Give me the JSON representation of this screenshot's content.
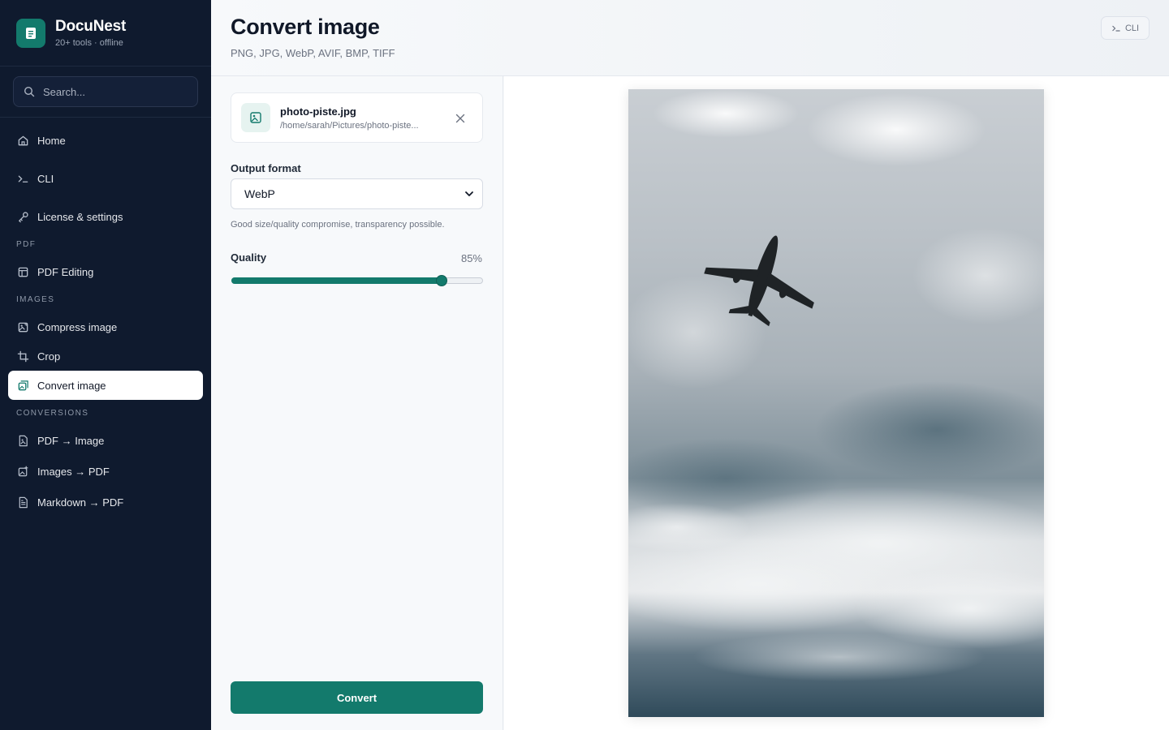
{
  "brand": {
    "title": "DocuNest",
    "subtitle": "20+ tools · offline",
    "logo_icon": "document-icon"
  },
  "search": {
    "placeholder": "Search..."
  },
  "nav": {
    "top": [
      {
        "label": "Home",
        "icon": "home-icon"
      },
      {
        "label": "CLI",
        "icon": "terminal-icon"
      },
      {
        "label": "License & settings",
        "icon": "key-icon"
      }
    ],
    "sections": [
      {
        "label": "PDF",
        "items": [
          {
            "label": "PDF Editing",
            "icon": "layout-icon"
          }
        ]
      },
      {
        "label": "IMAGES",
        "items": [
          {
            "label": "Compress image",
            "icon": "image-compress-icon"
          },
          {
            "label": "Crop",
            "icon": "crop-icon"
          },
          {
            "label": "Convert image",
            "icon": "image-convert-icon",
            "active": true
          }
        ]
      },
      {
        "label": "CONVERSIONS",
        "items": [
          {
            "label": "PDF → Image",
            "icon": "file-image-icon"
          },
          {
            "label": "Images → PDF",
            "icon": "image-plus-icon"
          },
          {
            "label": "Markdown → PDF",
            "icon": "file-text-icon"
          }
        ]
      }
    ]
  },
  "header": {
    "title": "Convert image",
    "subtitle": "PNG, JPG, WebP, AVIF, BMP, TIFF",
    "cli_label": "CLI"
  },
  "file": {
    "name": "photo-piste.jpg",
    "path": "/home/sarah/Pictures/photo-piste...",
    "icon": "image-icon"
  },
  "output_format": {
    "label": "Output format",
    "selected": "WebP",
    "hint": "Good size/quality compromise, transparency possible."
  },
  "quality": {
    "label": "Quality",
    "value_text": "85%",
    "value": 0.85
  },
  "convert_label": "Convert",
  "colors": {
    "accent": "#137a6c",
    "sidebar_bg": "#0f1a2e"
  }
}
